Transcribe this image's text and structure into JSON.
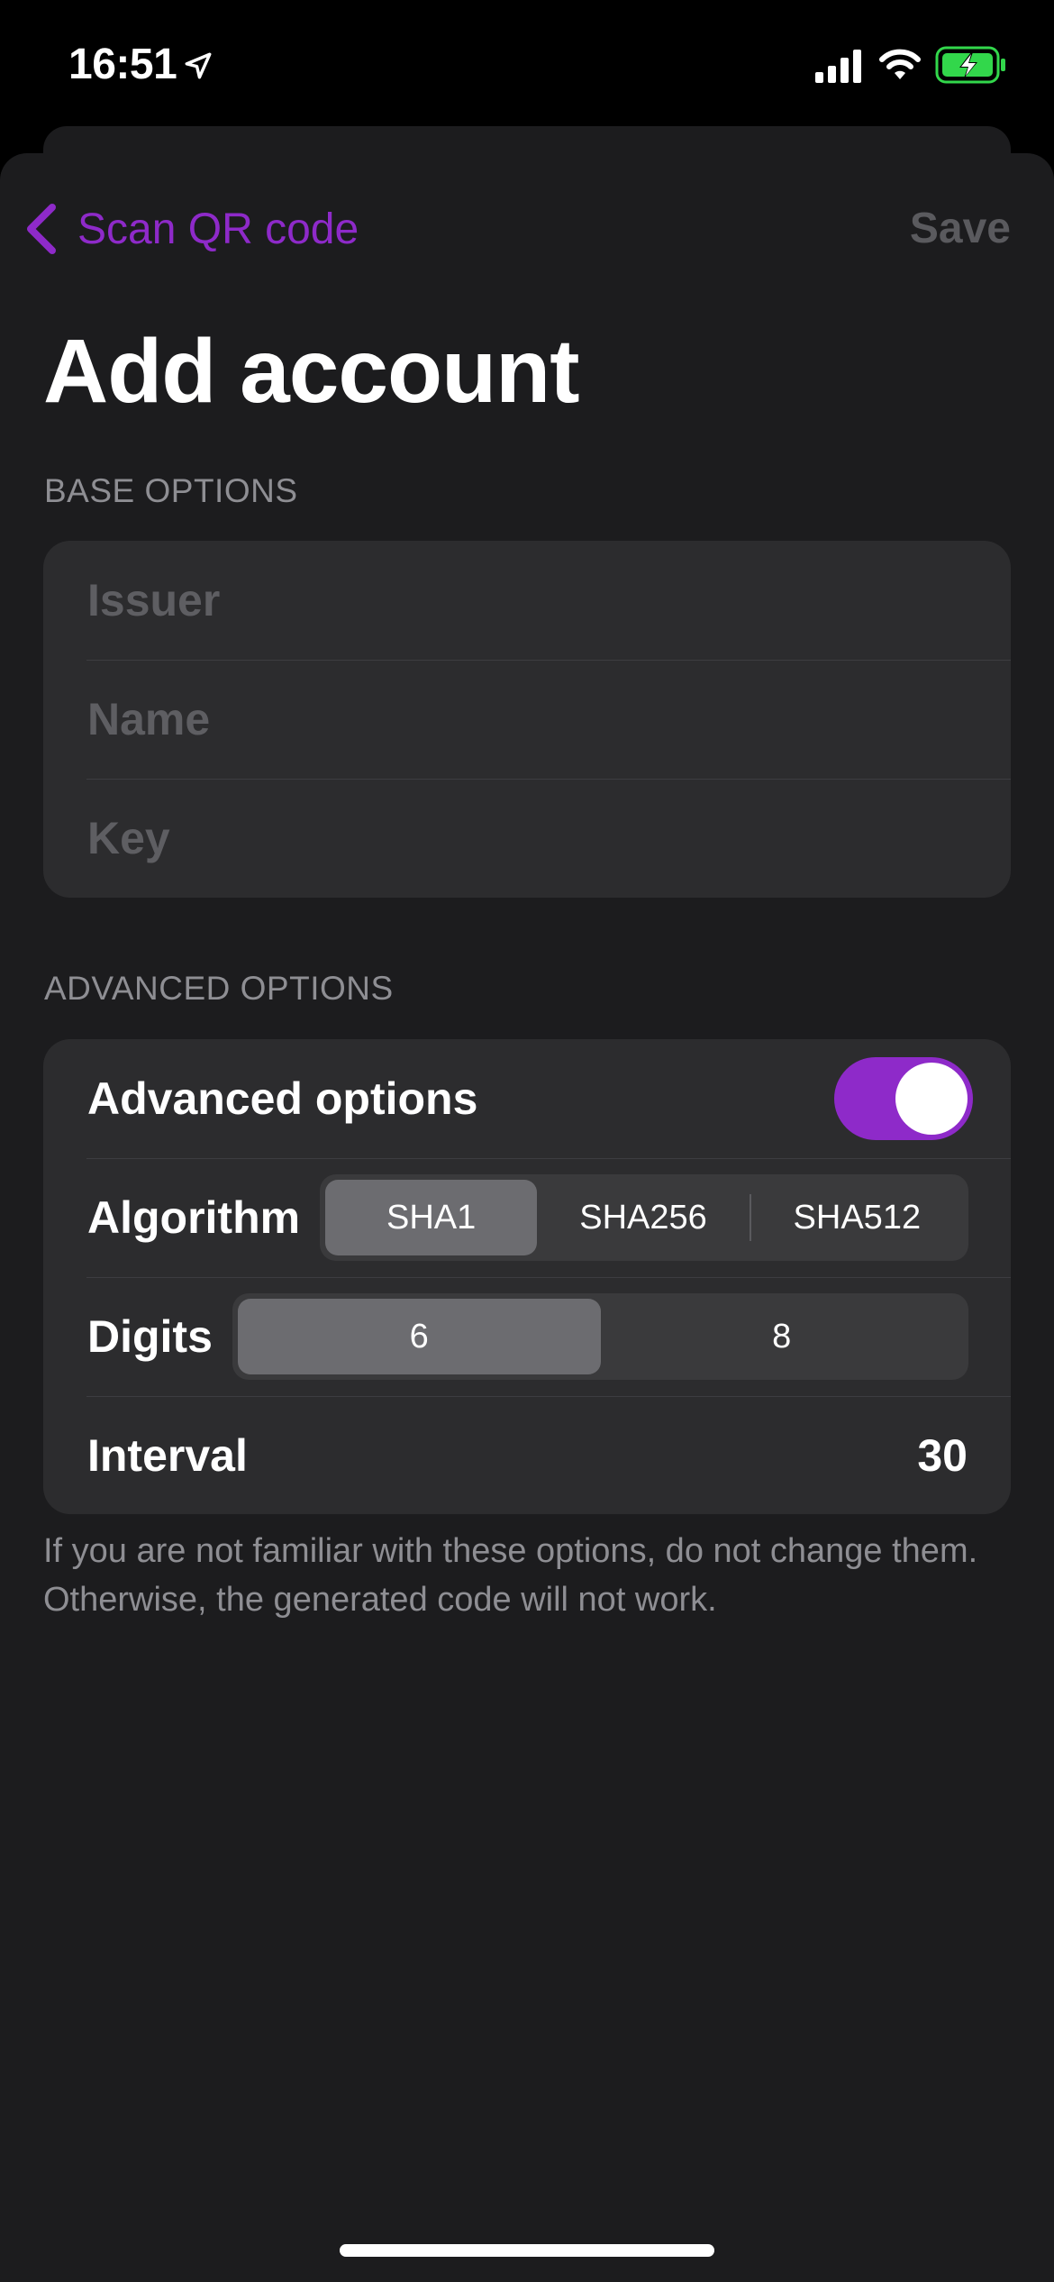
{
  "status_bar": {
    "time": "16:51",
    "location_icon": "location-arrow-icon",
    "signal_icon": "cellular-signal-icon",
    "wifi_icon": "wifi-icon",
    "battery_icon": "battery-charging-icon",
    "battery_color": "#32d74b"
  },
  "nav": {
    "back_label": "Scan QR code",
    "back_icon": "chevron-left-icon",
    "save_label": "Save"
  },
  "title": "Add account",
  "base_options": {
    "header": "BASE OPTIONS",
    "fields": [
      {
        "placeholder": "Issuer",
        "value": ""
      },
      {
        "placeholder": "Name",
        "value": ""
      },
      {
        "placeholder": "Key",
        "value": ""
      }
    ]
  },
  "advanced_options": {
    "header": "ADVANCED OPTIONS",
    "toggle_label": "Advanced options",
    "toggle_on": true,
    "algorithm": {
      "label": "Algorithm",
      "options": [
        "SHA1",
        "SHA256",
        "SHA512"
      ],
      "selected": "SHA1"
    },
    "digits": {
      "label": "Digits",
      "options": [
        "6",
        "8"
      ],
      "selected": "6"
    },
    "interval": {
      "label": "Interval",
      "value": "30"
    },
    "footer": "If you are not familiar with these options, do not change them. Otherwise, the generated code will not work."
  },
  "colors": {
    "accent": "#8e2ac9",
    "background": "#1c1c1e",
    "cell": "#2c2c2e",
    "secondary_text": "#8e8e93",
    "disabled_text": "#5a5a5e"
  }
}
